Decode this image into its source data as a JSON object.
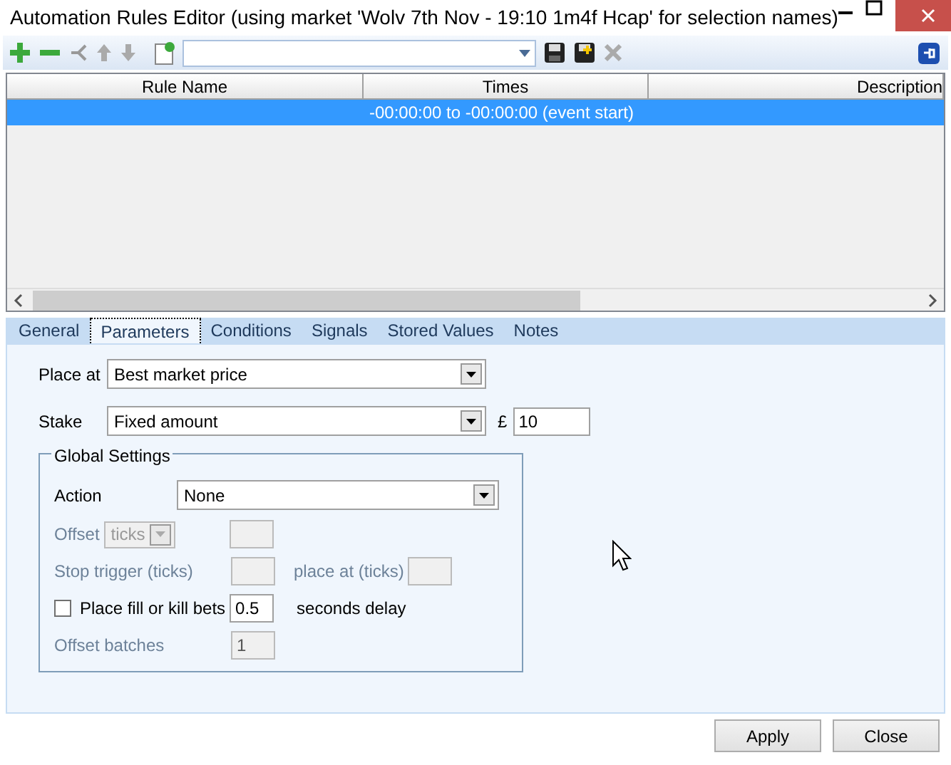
{
  "window": {
    "title": "Automation Rules Editor (using market 'Wolv 7th Nov - 19:10 1m4f Hcap' for selection names)"
  },
  "grid": {
    "columns": [
      "Rule Name",
      "Times",
      "Description"
    ],
    "rows": [
      {
        "times": "-00:00:00 to -00:00:00 (event start)",
        "selected": true
      }
    ]
  },
  "tabs": [
    {
      "label": "General",
      "selected": false
    },
    {
      "label": "Parameters",
      "selected": true
    },
    {
      "label": "Conditions",
      "selected": false
    },
    {
      "label": "Signals",
      "selected": false
    },
    {
      "label": "Stored Values",
      "selected": false
    },
    {
      "label": "Notes",
      "selected": false
    }
  ],
  "place_at": {
    "label": "Place at",
    "value": "Best market price"
  },
  "stake": {
    "label": "Stake",
    "value": "Fixed amount",
    "currency": "£",
    "amount": "10"
  },
  "global_settings": {
    "title": "Global Settings",
    "action": {
      "label": "Action",
      "value": "None"
    },
    "offset": {
      "label": "Offset",
      "unit": "ticks",
      "disabled": true
    },
    "stop_trigger": {
      "label": "Stop trigger (ticks)",
      "disabled": true
    },
    "place_at_ticks": {
      "label": "place at (ticks)",
      "disabled": true
    },
    "fill_or_kill": {
      "label": "Place fill or kill bets",
      "checked": false,
      "value": "0.5",
      "suffix": "seconds delay"
    },
    "offset_batches": {
      "label": "Offset batches",
      "value": "1",
      "disabled": true
    }
  },
  "buttons": [
    "Apply",
    "Close"
  ]
}
